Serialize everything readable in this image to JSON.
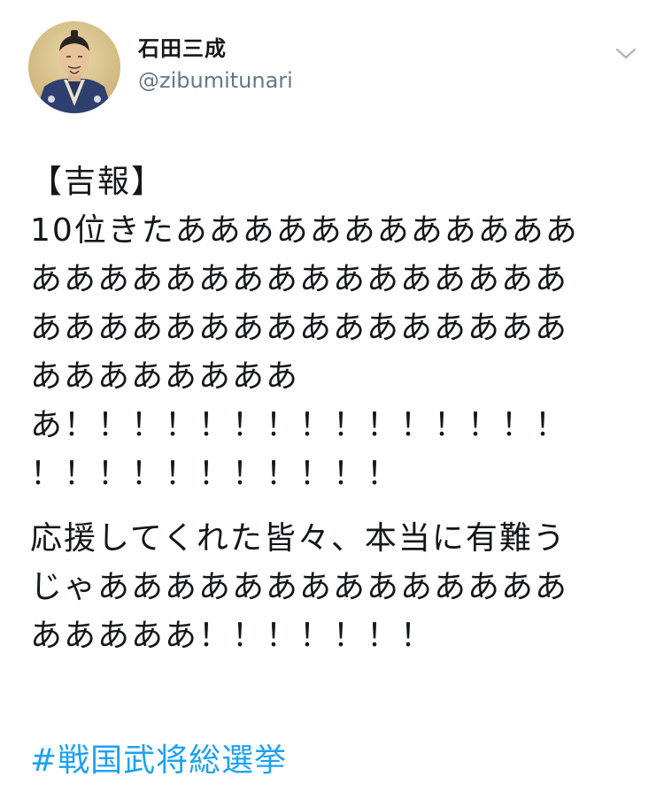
{
  "user": {
    "display_name": "石田三成",
    "handle": "@zibumitunari",
    "avatar_icon": "samurai-portrait-avatar"
  },
  "menu": {
    "icon": "chevron-down-icon"
  },
  "tweet": {
    "paragraphs": [
      "【吉報】\n10位きたああああああああああああ\nああああああああああああああああ\nああああああああああああああああ\nああああああああ\nあ！！！！！！！！！！！！！！！\n！！！！！！！！！！！",
      "応援してくれた皆々、本当に有難う\nじゃああああああああああああああ\nあああああ！！！！！！！"
    ],
    "hashtag": "#戦国武将総選挙"
  },
  "colors": {
    "text": "#14171a",
    "handle": "#657786",
    "link": "#1da1f2",
    "chevron": "#aab8c2"
  }
}
